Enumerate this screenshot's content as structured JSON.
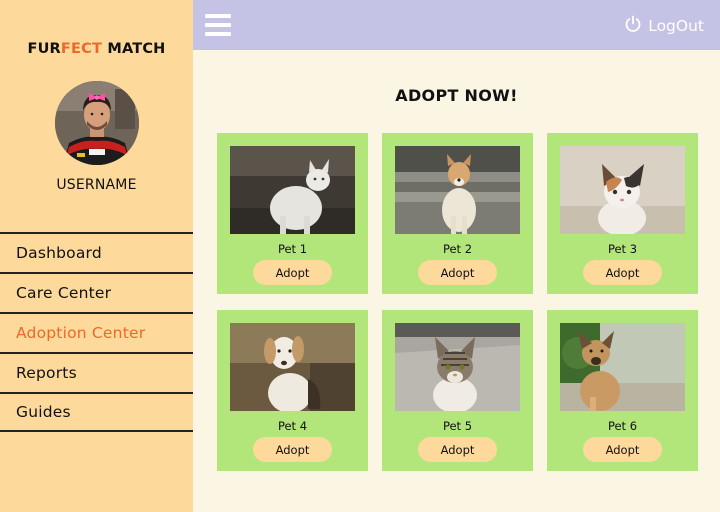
{
  "sidebar": {
    "brand_part1": "FUR",
    "brand_part2": "FECT",
    "brand_part3": " MATCH",
    "username": "USERNAME",
    "nav": [
      {
        "label": "Dashboard",
        "active": false
      },
      {
        "label": "Care Center",
        "active": false
      },
      {
        "label": "Adoption Center",
        "active": true
      },
      {
        "label": "Reports",
        "active": false
      },
      {
        "label": "Guides",
        "active": false
      }
    ]
  },
  "topbar": {
    "logout_label": "LogOut",
    "menu_icon": "hamburger-menu-icon",
    "logout_icon": "power-icon"
  },
  "main": {
    "title": "ADOPT NOW!",
    "pets": [
      {
        "name": "Pet 1",
        "button": "Adopt"
      },
      {
        "name": "Pet 2",
        "button": "Adopt"
      },
      {
        "name": "Pet 3",
        "button": "Adopt"
      },
      {
        "name": "Pet 4",
        "button": "Adopt"
      },
      {
        "name": "Pet 5",
        "button": "Adopt"
      },
      {
        "name": "Pet 6",
        "button": "Adopt"
      }
    ]
  },
  "colors": {
    "sidebar_bg": "#fdd99b",
    "topbar_bg": "#c4c3e5",
    "page_bg": "#fbf6e3",
    "card_bg": "#b3e67a",
    "accent": "#ea6a2a",
    "button_bg": "#fdd99b"
  }
}
